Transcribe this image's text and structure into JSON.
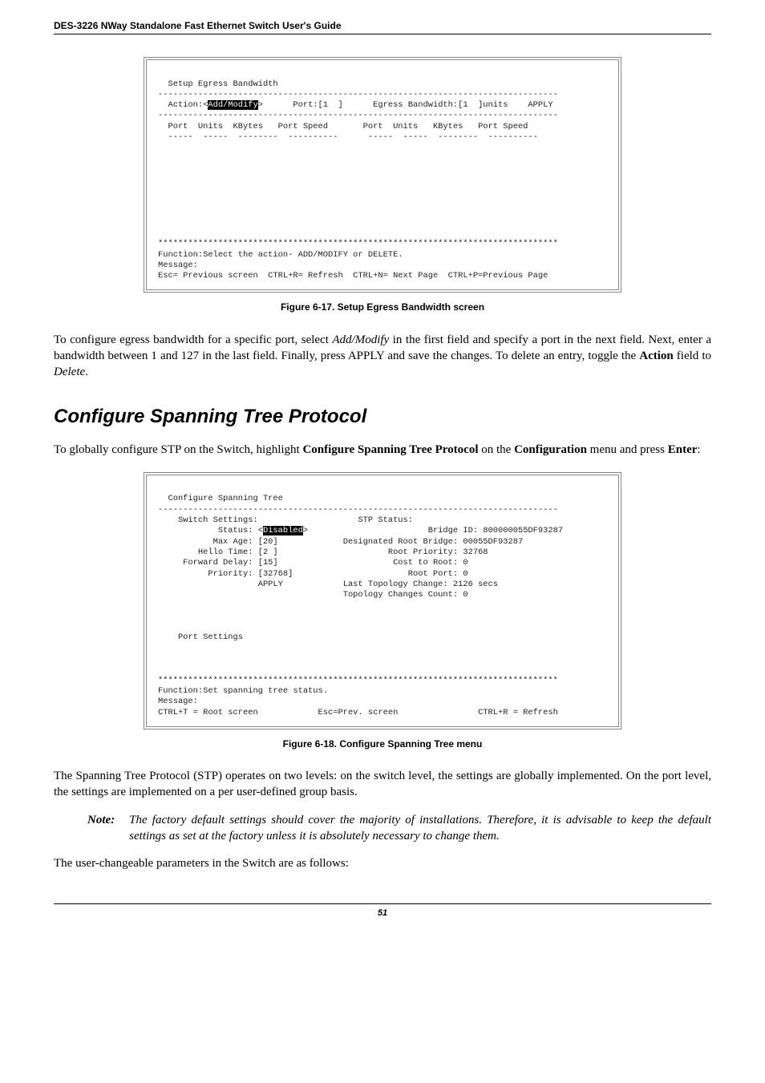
{
  "header": {
    "title": "DES-3226 NWay Standalone Fast Ethernet Switch User's Guide"
  },
  "fig1": {
    "caption": "Figure 6-17.  Setup Egress Bandwidth screen",
    "term": {
      "title": "  Setup Egress Bandwidth",
      "row_action_pre": "  Action:<",
      "row_action_inv": "Add/Modify",
      "row_action_post": ">      Port:[1  ]      Egress Bandwidth:[1  ]units    APPLY",
      "header_row": "  Port  Units  KBytes   Port Speed       Port  Units   KBytes   Port Speed",
      "dash_row": "  -----  -----  --------  ----------      -----  -----  --------  ----------",
      "stars": "********************************************************************************",
      "func": "Function:Select the action- ADD/MODIFY or DELETE.",
      "msg": "Message:",
      "foot": "Esc= Previous screen  CTRL+R= Refresh  CTRL+N= Next Page  CTRL+P=Previous Page"
    }
  },
  "para1": {
    "pre": "To configure egress bandwidth for a specific port, select ",
    "i1": "Add/Modify",
    "mid": " in the first field and specify a port in the next field. Next, enter a bandwidth between 1 and 127 in the last field. Finally, press APPLY and save the changes. To delete an entry, toggle the ",
    "b1": "Action",
    "post1": " field to ",
    "i2": "Delete",
    "end": "."
  },
  "section": {
    "title": "Configure Spanning Tree Protocol"
  },
  "intro": {
    "pre": "To globally configure STP on the Switch, highlight ",
    "b1": "Configure Spanning Tree Protocol",
    "mid": " on the ",
    "b2": "Configuration",
    "post": " menu and press ",
    "b3": "Enter",
    "end": ":"
  },
  "fig2": {
    "caption": "Figure 6-18.  Configure Spanning Tree menu",
    "term": {
      "title": "  Configure Spanning Tree",
      "l1": "    Switch Settings:                    STP Status:",
      "l2a": "            Status: <",
      "l2inv": "Disabled",
      "l2b": ">                        Bridge ID: 800000055DF93287",
      "l3": "           Max Age: [20]             Designated Root Bridge: 00055DF93287",
      "l4": "        Hello Time: [2 ]                      Root Priority: 32768",
      "l5": "     Forward Delay: [15]                       Cost to Root: 0",
      "l6": "          Priority: [32768]                       Root Port: 0",
      "l7": "                    APPLY            Last Topology Change: 2126 secs",
      "l8": "                                     Topology Changes Count: 0",
      "l9": "    Port Settings",
      "stars": "********************************************************************************",
      "func": "Function:Set spanning tree status.",
      "msg": "Message:",
      "foot": "CTRL+T = Root screen            Esc=Prev. screen                CTRL+R = Refresh"
    }
  },
  "para2": "The Spanning Tree Protocol (STP) operates on two levels: on the switch level, the settings are globally implemented. On the port level, the settings are implemented on a per user-defined group basis.",
  "note": {
    "label": "Note:",
    "body": "The factory default settings should cover the majority of installations. Therefore, it is advisable to keep the default settings as set at the factory unless it is absolutely necessary to change them."
  },
  "para3": "The user-changeable parameters in the Switch are as follows:",
  "pagenum": "51"
}
